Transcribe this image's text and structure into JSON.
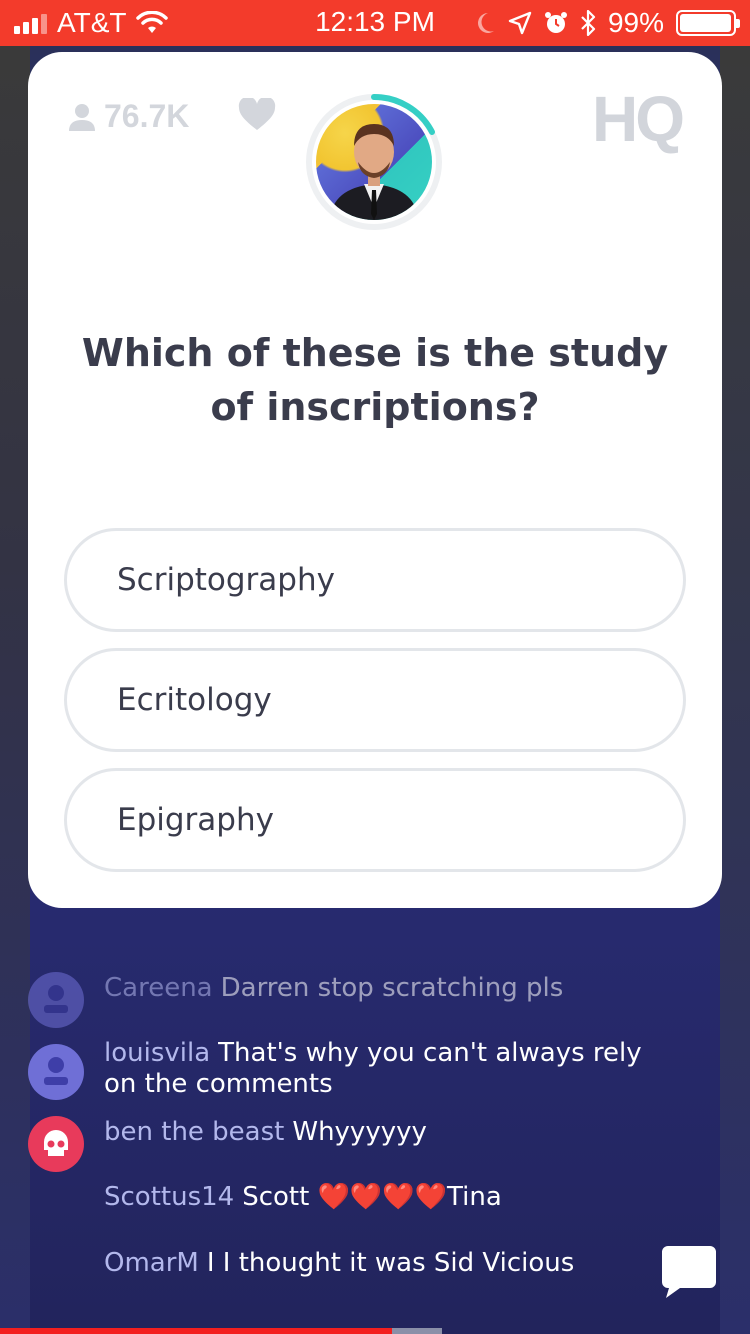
{
  "status_bar": {
    "carrier": "AT&T",
    "time": "12:13 PM",
    "battery": "99%",
    "battery_level": 0.99,
    "bg_color": "#f33b2b"
  },
  "header": {
    "viewer_count": "76.7K",
    "logo": "HQ",
    "icons": [
      "person-icon",
      "heart-icon"
    ]
  },
  "question": {
    "text": "Which of these is the study of inscriptions?"
  },
  "answers": [
    {
      "label": "Scriptography"
    },
    {
      "label": "Ecritology"
    },
    {
      "label": "Epigraphy"
    }
  ],
  "chat": [
    {
      "user": "Careena",
      "message": "Darren stop scratching pls",
      "avatar": "default",
      "faded": true
    },
    {
      "user": "louisvila",
      "message": "That's why you can't always rely on the comments",
      "avatar": "default"
    },
    {
      "user": "ben the beast",
      "message": "Whyyyyyy",
      "avatar": "skull"
    },
    {
      "user": "Scottus14",
      "message": "Scott ❤️❤️❤️❤️Tina",
      "avatar": "none"
    },
    {
      "user": "OmarM",
      "message": "I I thought it was Sid Vicious",
      "avatar": "none"
    }
  ],
  "colors": {
    "accent_red": "#f33b2b",
    "chat_username": "#b3b8ec",
    "question_text": "#3a3c4c"
  }
}
